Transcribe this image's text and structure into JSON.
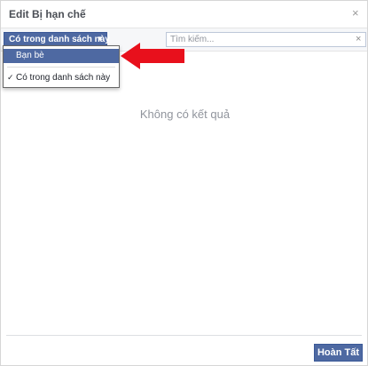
{
  "dialog": {
    "title": "Edit Bị hạn chế",
    "close_glyph": "×"
  },
  "toolbar": {
    "filter_label": "Có trong danh sách này",
    "filter_caret": "▼",
    "search_placeholder": "Tìm kiếm...",
    "search_clear": "×"
  },
  "dropdown": {
    "items": [
      {
        "label": "Bạn bè",
        "highlighted": true,
        "checked": false
      },
      {
        "label": "Có trong danh sách này",
        "highlighted": false,
        "checked": true
      }
    ],
    "check_glyph": "✓"
  },
  "main": {
    "empty_message": "Không có kết quả"
  },
  "footer": {
    "done_label": "Hoàn Tất"
  },
  "colors": {
    "accent": "#4e69a2",
    "annotation_arrow": "#e8101c"
  },
  "icons": [
    "close-icon",
    "caret-down-icon",
    "clear-icon",
    "checkmark-icon",
    "red-arrow-annotation"
  ]
}
